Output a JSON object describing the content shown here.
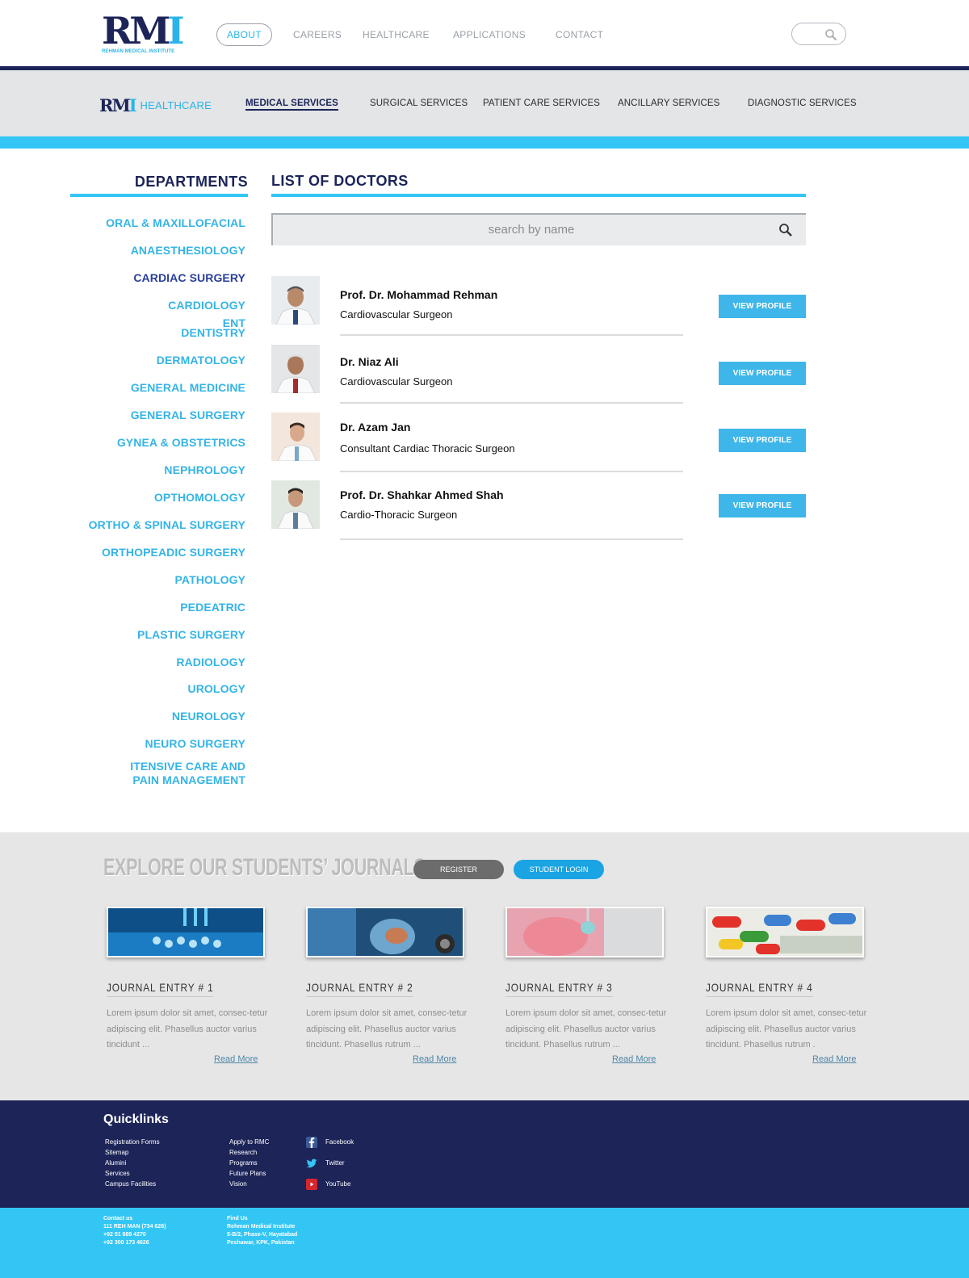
{
  "brand": {
    "logo_text_main": "RM",
    "logo_text_accent": "I",
    "logo_subtitle": "REHMAN MEDICAL INSTITUTE",
    "colors": {
      "navy": "#1c2458",
      "cyan": "#33c6f4",
      "button_blue": "#3fb6e9"
    }
  },
  "main_nav": {
    "items": [
      "ABOUT",
      "CAREERS",
      "HEALTHCARE",
      "APPLICATIONS",
      "CONTACT"
    ],
    "active": "ABOUT"
  },
  "top_search": {
    "icon": "search-icon"
  },
  "sub_header": {
    "section_word": "HEALTHCARE",
    "items": [
      "MEDICAL SERVICES",
      "SURGICAL SERVICES",
      "PATIENT CARE SERVICES",
      "ANCILLARY SERVICES",
      "DIAGNOSTIC SERVICES"
    ],
    "active": "MEDICAL SERVICES"
  },
  "departments": {
    "title": "DEPARTMENTS",
    "items": [
      "ORAL & MAXILLOFACIAL",
      "ANAESTHESIOLOGY",
      "CARDIAC SURGERY",
      "CARDIOLOGY",
      "ENT",
      "DENTISTRY",
      "DERMATOLOGY",
      "GENERAL MEDICINE",
      "GENERAL SURGERY",
      "GYNEA & OBSTETRICS",
      "NEPHROLOGY",
      "OPTHOMOLOGY",
      "ORTHO & SPINAL SURGERY",
      "ORTHOPEADIC SURGERY",
      "PATHOLOGY",
      "PEDEATRIC",
      "PLASTIC SURGERY",
      "RADIOLOGY",
      "UROLOGY",
      "NEUROLOGY",
      "NEURO SURGERY",
      "ITENSIVE CARE AND PAIN MANAGEMENT"
    ],
    "selected": "CARDIAC SURGERY"
  },
  "doctors": {
    "title": "LIST OF DOCTORS",
    "search_placeholder": "search by name",
    "button_label": "VIEW PROFILE",
    "list": [
      {
        "name": "Prof. Dr. Mohammad Rehman",
        "role": "Cardiovascular Surgeon"
      },
      {
        "name": "Dr. Niaz Ali",
        "role": "Cardiovascular Surgeon"
      },
      {
        "name": "Dr. Azam Jan",
        "role": "Consultant Cardiac Thoracic Surgeon"
      },
      {
        "name": "Prof. Dr. Shahkar Ahmed Shah",
        "role": "Cardio-Thoracic Surgeon"
      }
    ]
  },
  "journals": {
    "title": "EXPLORE OUR STUDENTS’ JOURNALS",
    "register_label": "REGISTER",
    "login_label": "STUDENT LOGIN",
    "read_more": "Read More",
    "entries": [
      {
        "title": "JOURNAL ENTRY # 1",
        "text": "Lorem ipsum dolor sit amet, consec-tetur adipiscing elit. Phasellus auctor varius tincidunt ..."
      },
      {
        "title": "JOURNAL ENTRY # 2",
        "text": "Lorem ipsum dolor sit amet, consec-tetur adipiscing elit. Phasellus auctor varius tincidunt. Phasellus rutrum ..."
      },
      {
        "title": "JOURNAL ENTRY # 3",
        "text": "Lorem ipsum dolor sit amet, consec-tetur adipiscing elit. Phasellus auctor varius tincidunt. Phasellus rutrum ..."
      },
      {
        "title": "JOURNAL ENTRY # 4",
        "text": "Lorem ipsum dolor sit amet, consec-tetur adipiscing elit. Phasellus auctor varius tincidunt. Phasellus rutrum ."
      }
    ]
  },
  "footer": {
    "quicklinks_title": "Quicklinks",
    "col1": [
      "Registration Forms",
      "Sitemap",
      "Alumini",
      "Services",
      "Campus Facilities"
    ],
    "col2": [
      "Apply to RMC",
      "Research",
      "Programs",
      "Future Plans",
      "Vision"
    ],
    "social": [
      {
        "label": "Facebook",
        "icon": "facebook-icon",
        "color": "#3b5998"
      },
      {
        "label": "Twitter",
        "icon": "twitter-icon",
        "color": "#33c6f4"
      },
      {
        "label": "YouTube",
        "icon": "youtube-icon",
        "color": "#d6262d"
      }
    ],
    "contact": [
      "Contact us",
      "111 REH MAN (734 626)",
      "+92 51 989 4270",
      "+92 300 173 4626"
    ],
    "find_us": [
      "Find Us",
      "Rehman Medical Institute",
      "5-B/2, Phase-V, Hayatabad",
      "Peshawar, KPK, Pakistan"
    ]
  }
}
